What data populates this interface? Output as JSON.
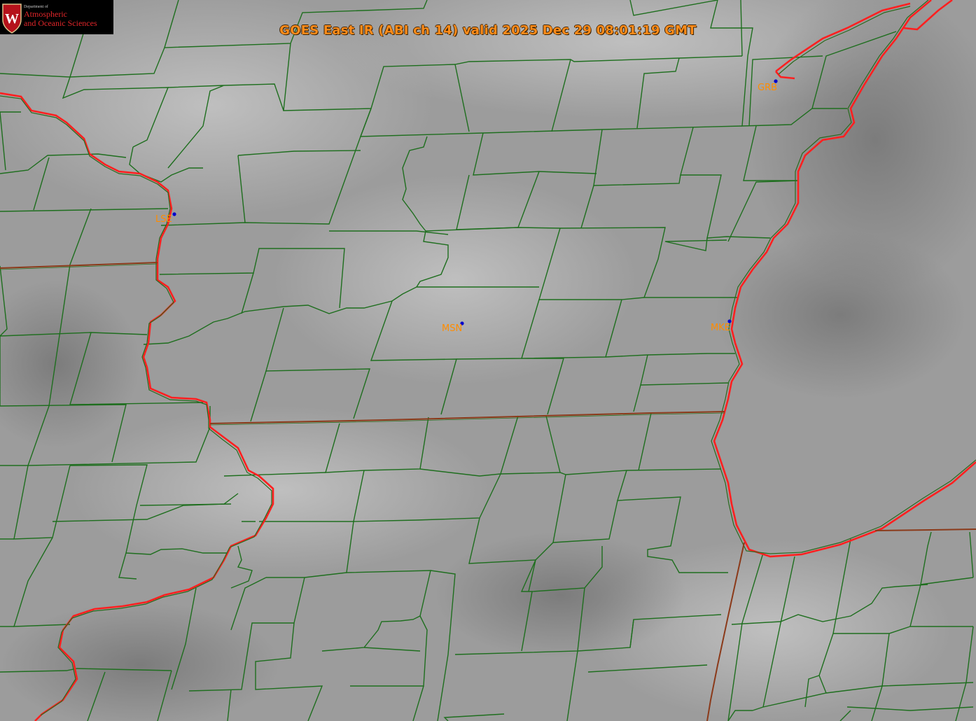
{
  "title": "GOES East IR (ABI ch 14) valid 2025 Dec 29 08:01:19 GMT",
  "logo": {
    "department": "Department of",
    "line1": "Atmospheric",
    "line2": "and Oceanic Sciences",
    "emblem_letter": "W"
  },
  "stations": [
    {
      "id": "LSE"
    },
    {
      "id": "MSN"
    },
    {
      "id": "MKE"
    },
    {
      "id": "GRB"
    }
  ],
  "colors": {
    "county_lines": "#1e6e1e",
    "state_lines": "#8b3a1a",
    "rivers_coast": "#ff1a1a",
    "station_dot": "#0000cc",
    "station_label": "#ff8c00",
    "title_text": "#ff8c1a",
    "logo_red": "#e2262a"
  }
}
